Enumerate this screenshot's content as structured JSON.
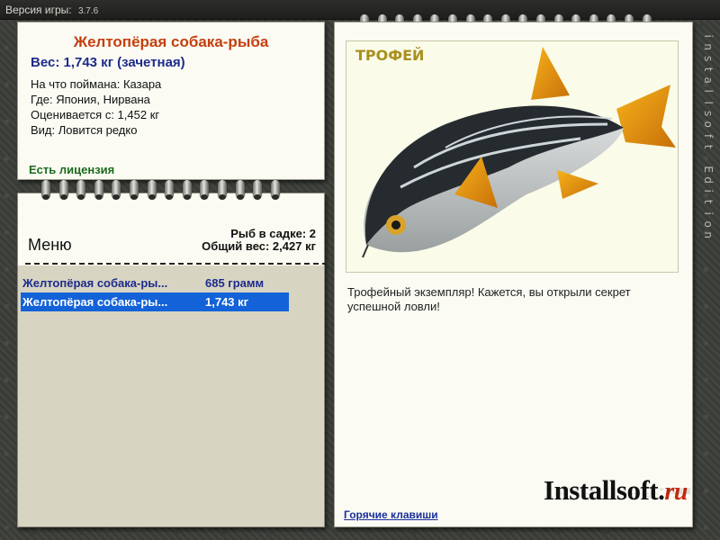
{
  "version_bar": {
    "label": "Версия игры:",
    "version": "3.7.6"
  },
  "watermark": "installsoft Edition",
  "fish_info": {
    "title": "Желтопёрая собака-рыба",
    "weight": "Вес: 1,743 кг (зачетная)",
    "details": [
      "На что поймана: Казара",
      "Где: Япония, Нирвана",
      "Оценивается с: 1,452 кг",
      "Вид: Ловится редко"
    ],
    "license": "Есть лицензия"
  },
  "menu": {
    "title": "Меню",
    "basket_count": "Рыб в садке: 2",
    "total_weight": "Общий вес: 2,427 кг",
    "catches": [
      {
        "name": "Желтопёрая собака-ры...",
        "weight": "685 грамм",
        "selected": false
      },
      {
        "name": "Желтопёрая собака-ры...",
        "weight": "1,743 кг",
        "selected": true
      }
    ]
  },
  "trophy": {
    "label": "ТРОФЕЙ",
    "text": "Трофейный экземпляр! Кажется, вы открыли секрет успешной ловли!",
    "hotkeys": "Горячие клавиши"
  },
  "logo": {
    "main": "Installsoft.",
    "suffix": "ru"
  },
  "colors": {
    "title_orange": "#c53f0e",
    "weight_blue": "#1e2b8a",
    "license_green": "#1c6b1c",
    "selection_blue": "#1462d8",
    "trophy_gold": "#a98f20"
  }
}
